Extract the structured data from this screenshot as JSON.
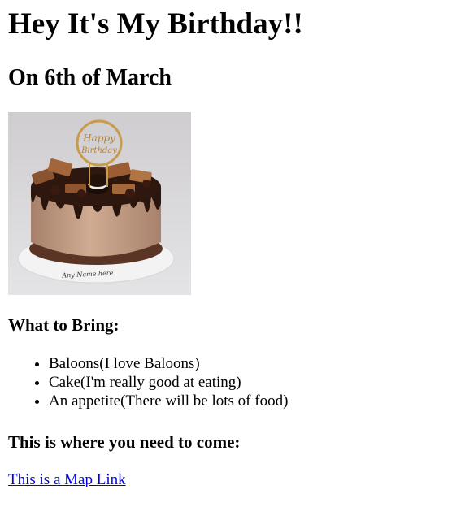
{
  "heading": "Hey It's My Birthday!!",
  "subheading": "On 6th of March",
  "image": {
    "topper_text_1": "Happy",
    "topper_text_2": "Birthday",
    "plate_text": "Any Name here"
  },
  "bring": {
    "title": "What to Bring:",
    "items": [
      {
        "label": "Baloons(I love Baloons)"
      },
      {
        "label": "Cake(I'm really good at eating)"
      },
      {
        "label": "An appetite(There will be lots of food)"
      }
    ]
  },
  "location": {
    "title": "This is where you need to come:",
    "link_text": "This is a Map Link"
  },
  "colors": {
    "link": "#0000ee",
    "text": "#000000",
    "background": "#ffffff"
  }
}
